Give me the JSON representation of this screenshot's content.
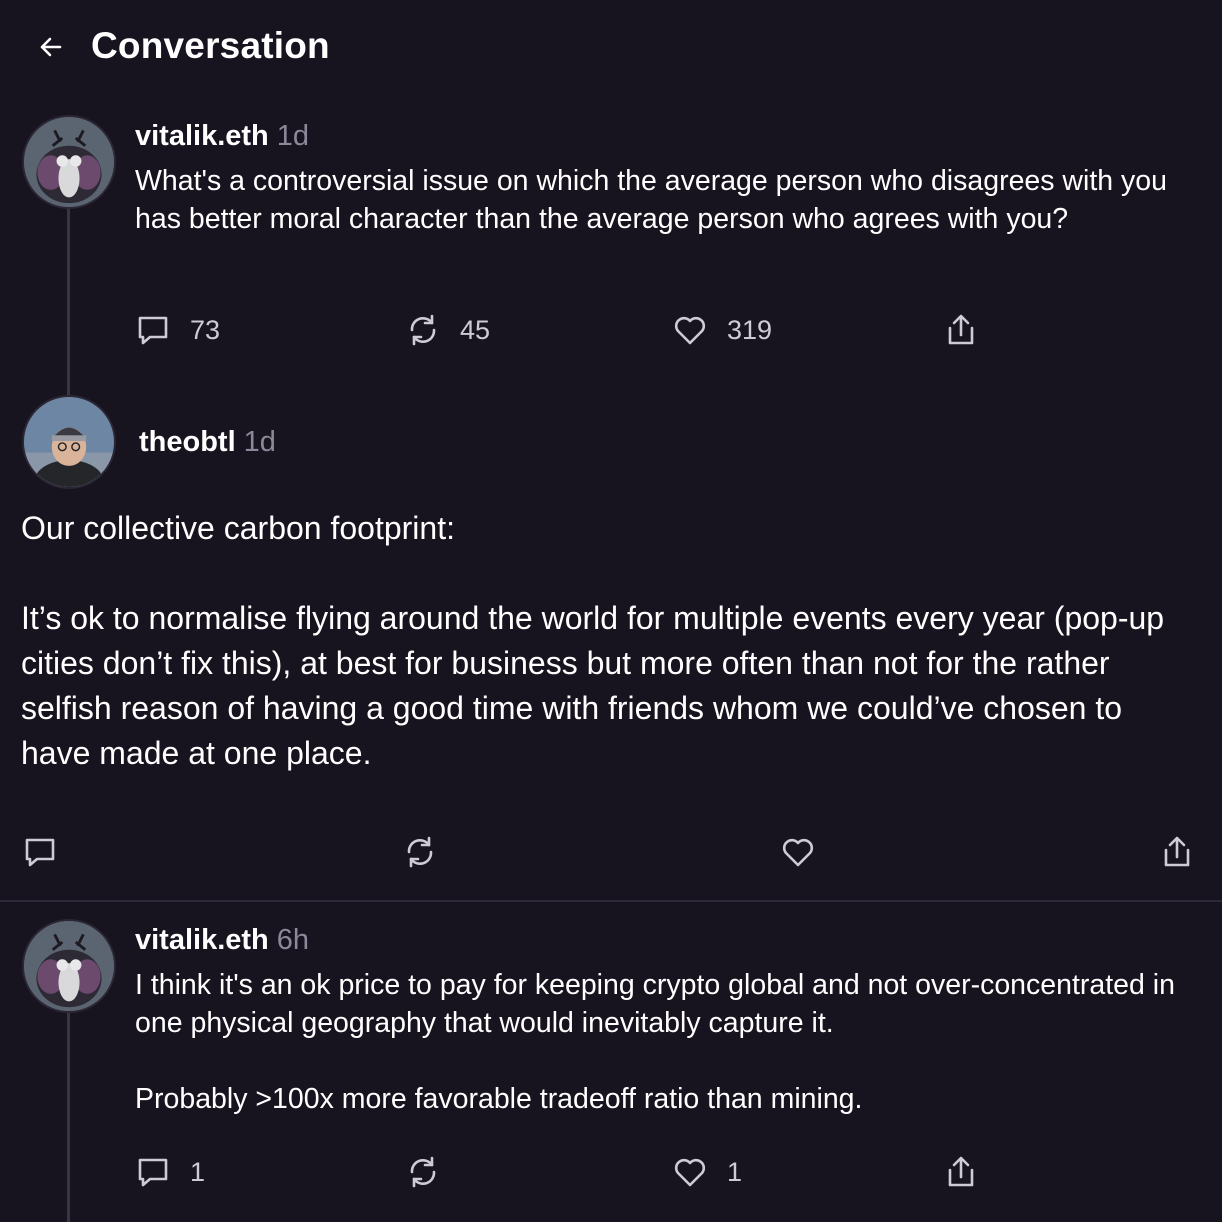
{
  "header": {
    "title": "Conversation",
    "back_icon": "arrow-left-icon"
  },
  "posts": [
    {
      "author": "vitalik.eth",
      "time": "1d",
      "text": "What's a controversial issue on which the average person who disagrees with you has better moral character than the average person who agrees with you?",
      "actions": {
        "comments": "73",
        "recasts": "45",
        "likes": "319"
      }
    },
    {
      "author": "theobtl",
      "time": "1d",
      "text": "Our collective carbon footprint:\n\nIt’s ok to normalise flying around the world for multiple events every year (pop-up cities don’t fix this), at best for business but more often than not for the rather selfish reason of having a good time with friends whom we could’ve chosen to have made at one place.",
      "actions": {
        "comments": "",
        "recasts": "",
        "likes": ""
      }
    },
    {
      "author": "vitalik.eth",
      "time": "6h",
      "text": "I think it's an ok price to pay for keeping crypto global and not over-concentrated in one physical geography that would inevitably capture it.\n\nProbably >100x more favorable tradeoff ratio than mining.",
      "actions": {
        "comments": "1",
        "recasts": "",
        "likes": "1"
      }
    }
  ],
  "icons": [
    "comment-icon",
    "recast-icon",
    "heart-icon",
    "share-icon"
  ],
  "colors": {
    "background": "#17131f",
    "muted": "#8d8899",
    "line": "#3a3545"
  }
}
